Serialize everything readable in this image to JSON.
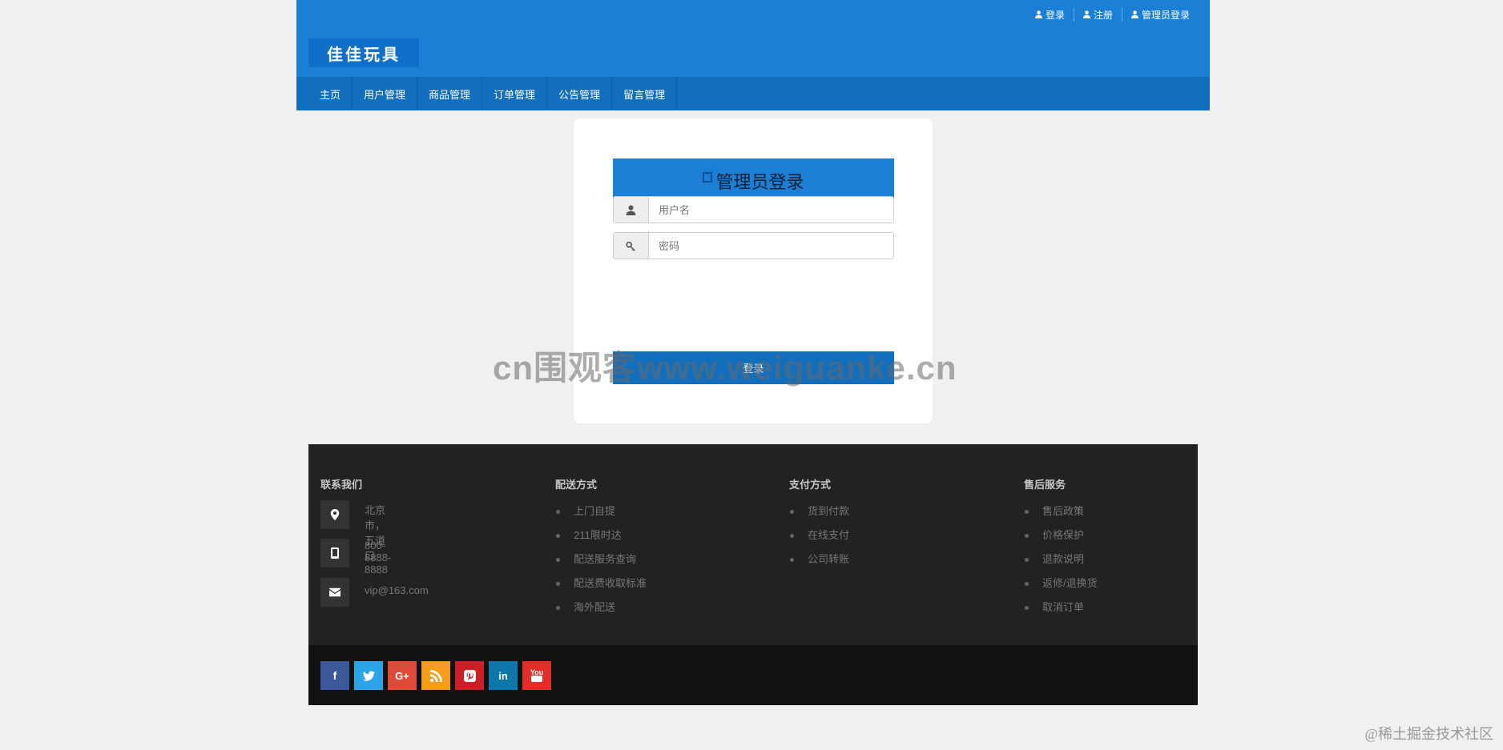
{
  "header": {
    "top_links": [
      {
        "label": "登录"
      },
      {
        "label": "注册"
      },
      {
        "label": "管理员登录"
      }
    ],
    "logo": "佳佳玩具",
    "nav": [
      "主页",
      "用户管理",
      "商品管理",
      "订单管理",
      "公告管理",
      "留言管理"
    ]
  },
  "login": {
    "title": "管理员登录",
    "username_placeholder": "用户名",
    "password_placeholder": "密码",
    "submit_label": "登录"
  },
  "watermark": "cn围观客www.weiguanke.cn",
  "footer": {
    "contact": {
      "title": "联系我们",
      "address": "北京市，五道口",
      "phone": "800-8888-8888",
      "email": "vip@163.com"
    },
    "delivery": {
      "title": "配送方式",
      "items": [
        "上门自提",
        "211限时达",
        "配送服务查询",
        "配送费收取标准",
        "海外配送"
      ]
    },
    "payment": {
      "title": "支付方式",
      "items": [
        "货到付款",
        "在线支付",
        "公司转账"
      ]
    },
    "service": {
      "title": "售后服务",
      "items": [
        "售后政策",
        "价格保护",
        "退款说明",
        "返修/退换货",
        "取消订单"
      ]
    },
    "social": [
      {
        "icon": "facebook-icon",
        "glyph": "f",
        "color": "#3b5998"
      },
      {
        "icon": "twitter-icon",
        "glyph": "",
        "color": "#2ba4e8"
      },
      {
        "icon": "google-plus-icon",
        "glyph": "G+",
        "color": "#dd4b39"
      },
      {
        "icon": "rss-icon",
        "glyph": "",
        "color": "#f59c1a"
      },
      {
        "icon": "pinterest-icon",
        "glyph": "",
        "color": "#cb2027"
      },
      {
        "icon": "linkedin-icon",
        "glyph": "in",
        "color": "#0e76a8"
      },
      {
        "icon": "youtube-icon",
        "glyph": "You",
        "color": "#e52d27"
      }
    ]
  },
  "corner_watermark": "@稀土掘金技术社区"
}
